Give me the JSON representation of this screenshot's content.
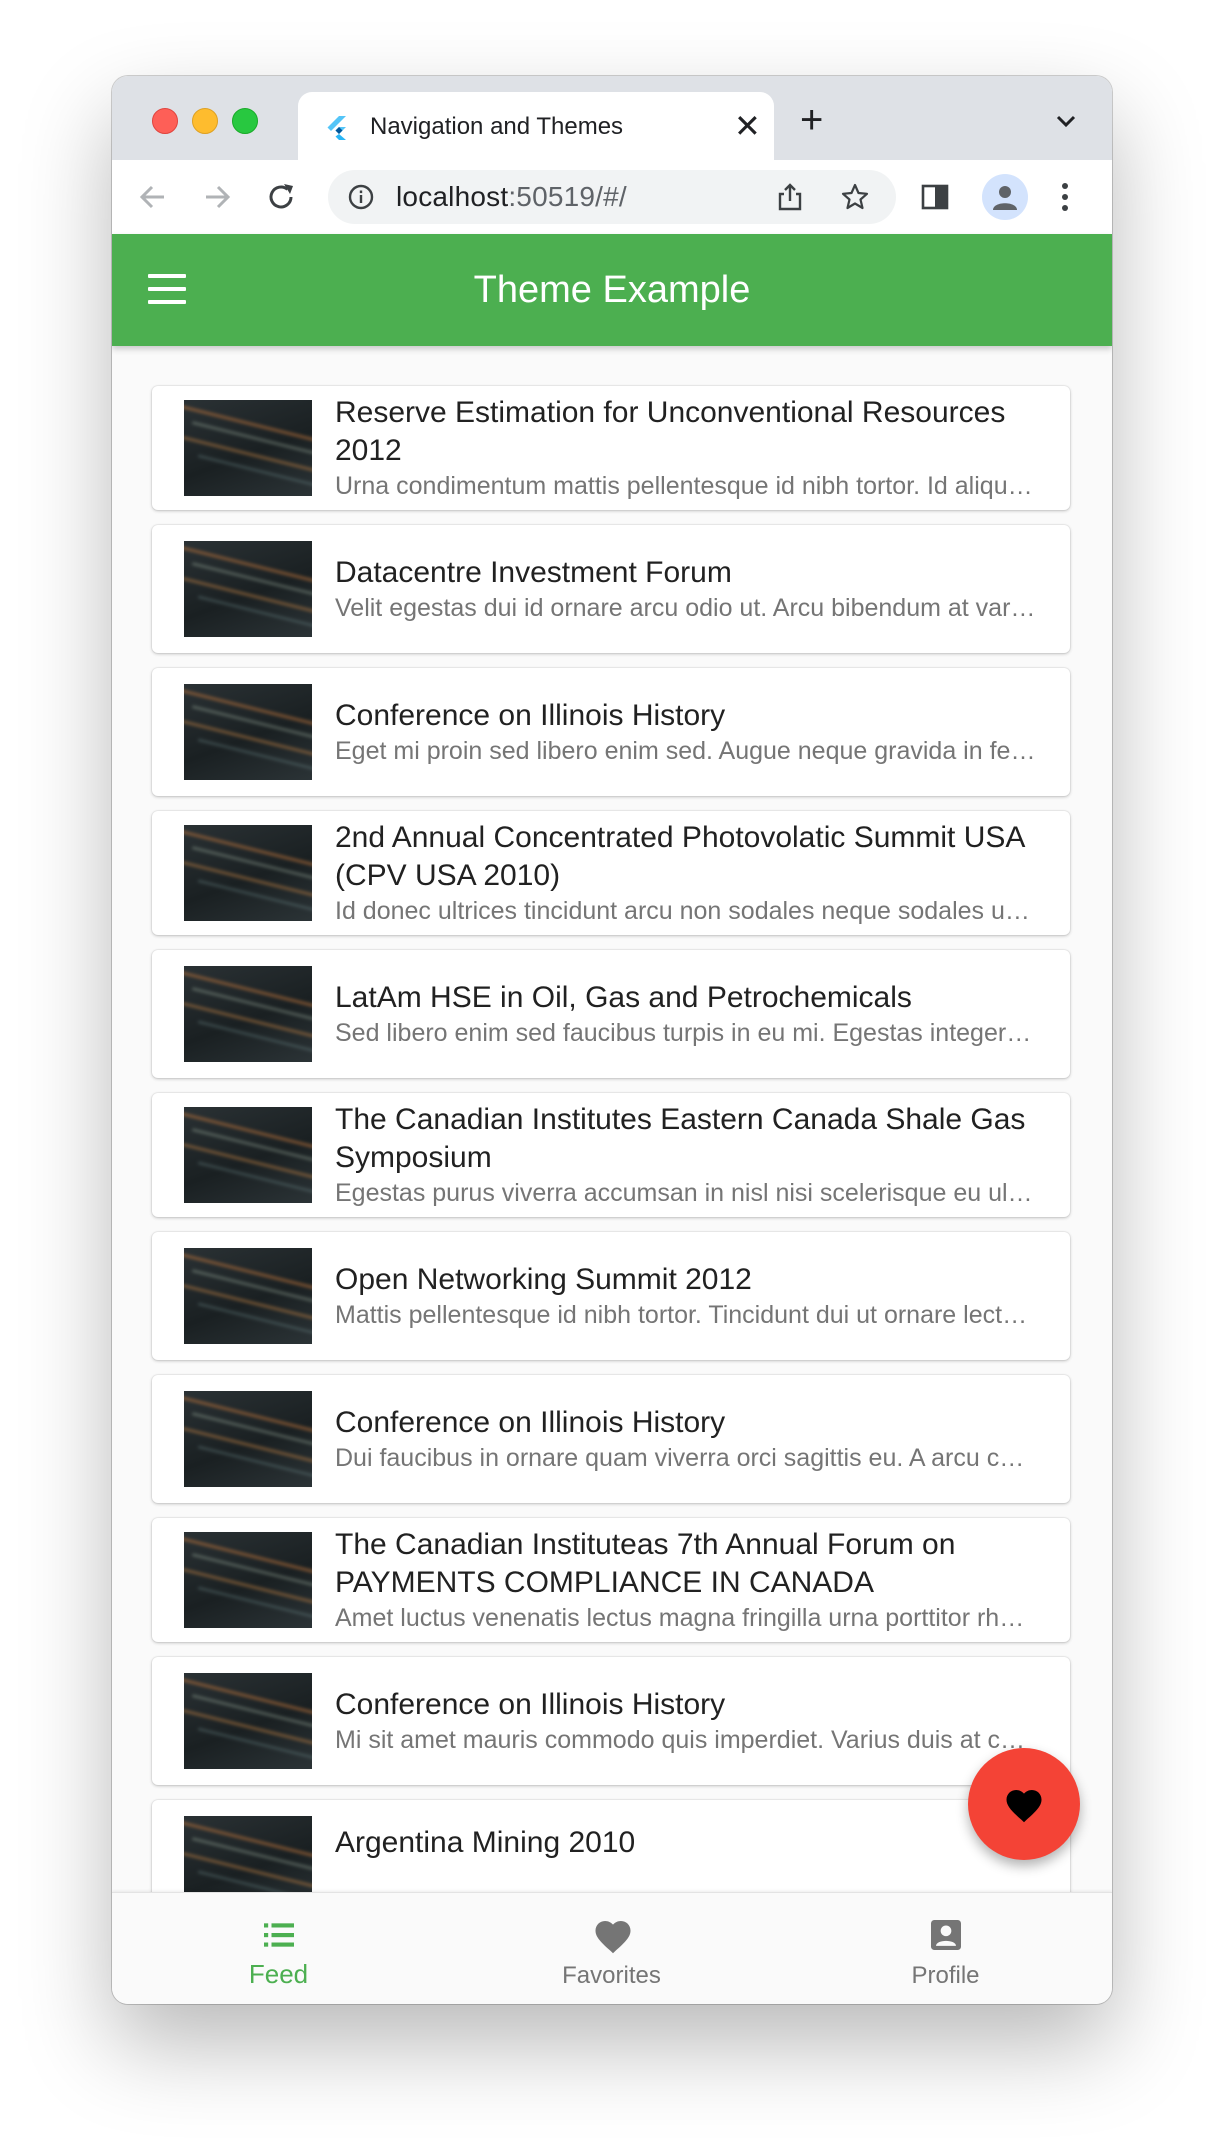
{
  "browser": {
    "tab_title": "Navigation and Themes",
    "tab_close": "✕",
    "new_tab": "+",
    "url_host": "localhost",
    "url_rest": ":50519/#/"
  },
  "app": {
    "title": "Theme Example",
    "accent_color": "#4caf50",
    "fab_color": "#f44336"
  },
  "feed": {
    "items": [
      {
        "title": "Reserve Estimation for Unconventional Resources 2012",
        "subtitle": "Urna condimentum mattis pellentesque id nibh tortor. Id aliquet lectus proin nibh nisl condimentum id venenatis."
      },
      {
        "title": "Datacentre Investment Forum",
        "subtitle": "Velit egestas dui id ornare arcu odio ut. Arcu bibendum at varius vel pharetra vel turpis nunc."
      },
      {
        "title": "Conference on Illinois History",
        "subtitle": "Eget mi proin sed libero enim sed. Augue neque gravida in fermentum et sollicitudin ac orci."
      },
      {
        "title": "2nd Annual Concentrated Photovolatic Summit USA (CPV USA 2010)",
        "subtitle": "Id donec ultrices tincidunt arcu non sodales neque sodales ut etiam sit amet nisl."
      },
      {
        "title": "LatAm HSE in Oil, Gas and Petrochemicals",
        "subtitle": "Sed libero enim sed faucibus turpis in eu mi. Egestas integer eget aliquet nibh praesent."
      },
      {
        "title": "The Canadian Institutes Eastern Canada Shale Gas Symposium",
        "subtitle": "Egestas purus viverra accumsan in nisl nisi scelerisque eu ultrices vitae auctor eu augue."
      },
      {
        "title": "Open Networking Summit 2012",
        "subtitle": "Mattis pellentesque id nibh tortor. Tincidunt dui ut ornare lectus sit amet est placerat."
      },
      {
        "title": "Conference on Illinois History",
        "subtitle": "Dui faucibus in ornare quam viverra orci sagittis eu. A arcu cursus vitae congue mauris."
      },
      {
        "title": "The Canadian Instituteas 7th Annual Forum on PAYMENTS COMPLIANCE IN CANADA",
        "subtitle": "Amet luctus venenatis lectus magna fringilla urna porttitor rhoncus dolor purus non enim."
      },
      {
        "title": "Conference on Illinois History",
        "subtitle": "Mi sit amet mauris commodo quis imperdiet. Varius duis at consectetur lorem donec massa."
      },
      {
        "title": "Argentina Mining 2010",
        "subtitle": ""
      }
    ]
  },
  "bottom_nav": {
    "items": [
      {
        "label": "Feed",
        "icon": "list-icon",
        "active": true
      },
      {
        "label": "Favorites",
        "icon": "heart-icon",
        "active": false
      },
      {
        "label": "Profile",
        "icon": "account-box-icon",
        "active": false
      }
    ]
  }
}
